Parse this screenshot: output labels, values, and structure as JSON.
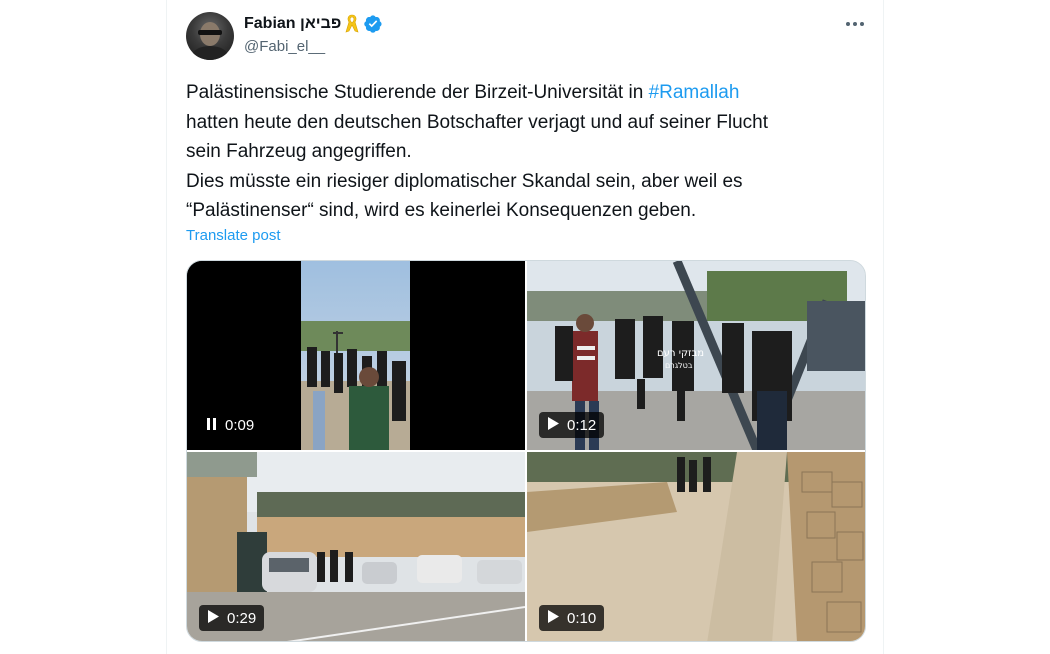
{
  "author": {
    "display_name": "Fabian פביאן",
    "handle": "@Fabi_el__",
    "avatar_icon": "profile-photo",
    "ribbon_icon": "yellow-ribbon-icon",
    "verified_icon": "verified-badge-icon"
  },
  "header": {
    "more_icon": "more-horizontal-icon"
  },
  "post": {
    "line1_before": "Palästinensische Studierende der Birzeit-Universität in ",
    "hashtag": "#Ramallah",
    "line2": "hatten heute den deutschen Botschafter verjagt und auf seiner Flucht",
    "line3": "sein Fahrzeug angegriffen.",
    "line4": "Dies müsste ein riesiger diplomatischer Skandal sein, aber weil es",
    "line5": "“Palästinenser“ sind, wird es keinerlei Konsequenzen geben.",
    "translate_label": "Translate post"
  },
  "media": [
    {
      "duration": "0:09",
      "state": "playing",
      "control_icon": "pause-icon"
    },
    {
      "duration": "0:12",
      "state": "paused",
      "control_icon": "play-icon"
    },
    {
      "duration": "0:29",
      "state": "paused",
      "control_icon": "play-icon"
    },
    {
      "duration": "0:10",
      "state": "paused",
      "control_icon": "play-icon"
    }
  ],
  "colors": {
    "link": "#1d9bf0",
    "text": "#0f1419",
    "secondary": "#536471",
    "verified": "#1d9bf0",
    "ribbon": "#f5c518"
  }
}
